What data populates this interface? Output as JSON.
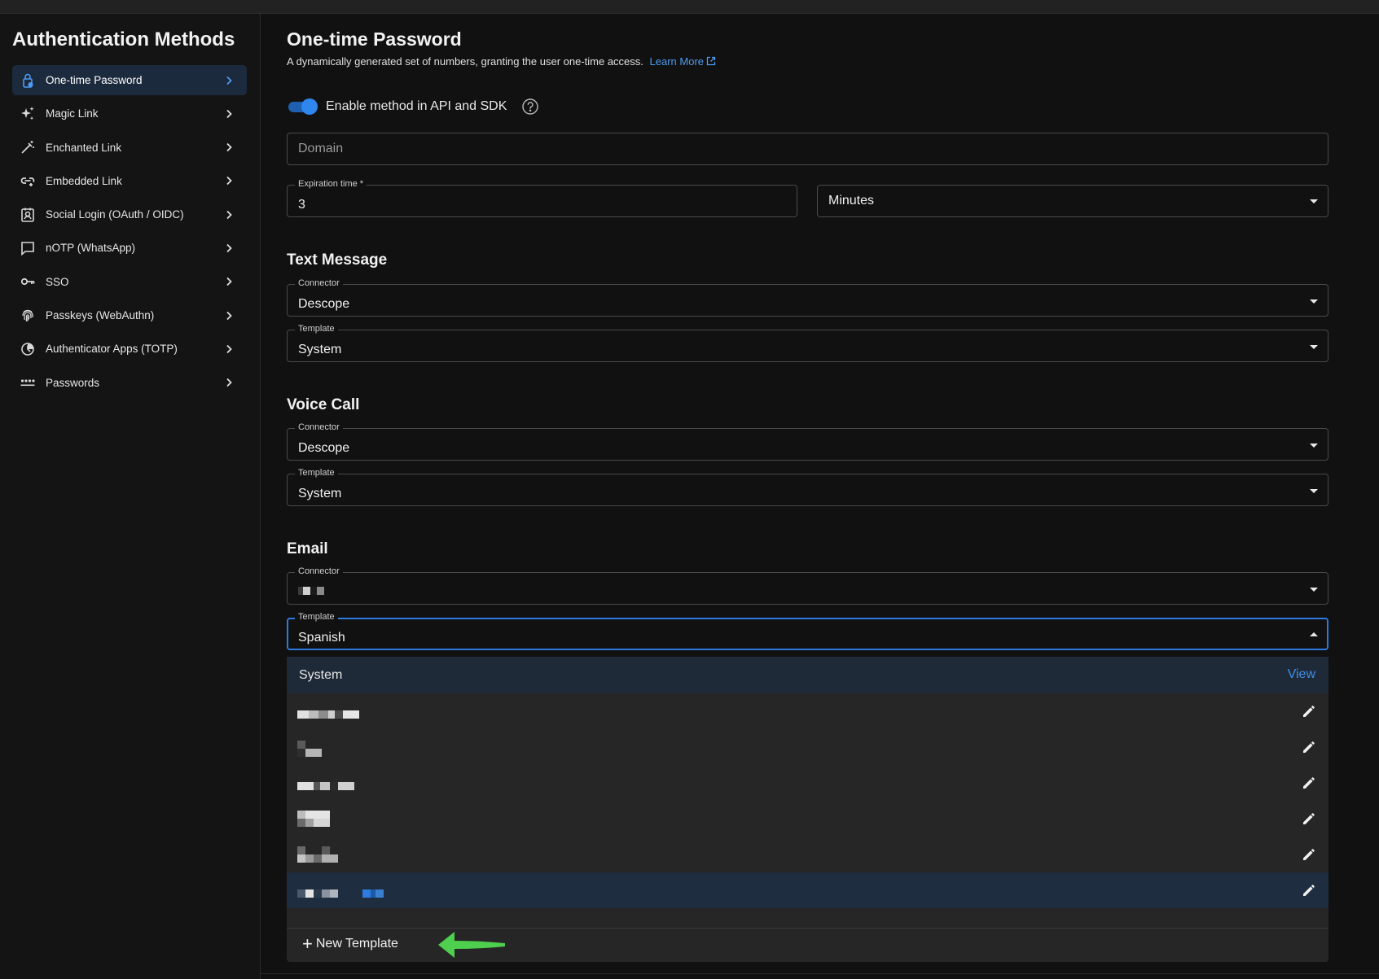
{
  "sidebar": {
    "title": "Authentication Methods",
    "items": [
      {
        "label": "One-time Password",
        "icon": "lock-phone-icon",
        "active": true
      },
      {
        "label": "Magic Link",
        "icon": "sparkles-icon"
      },
      {
        "label": "Enchanted Link",
        "icon": "magic-wand-icon"
      },
      {
        "label": "Embedded Link",
        "icon": "link-icon"
      },
      {
        "label": "Social Login (OAuth / OIDC)",
        "icon": "contact-card-icon"
      },
      {
        "label": "nOTP (WhatsApp)",
        "icon": "chat-bubble-icon"
      },
      {
        "label": "SSO",
        "icon": "key-icon"
      },
      {
        "label": "Passkeys (WebAuthn)",
        "icon": "fingerprint-icon"
      },
      {
        "label": "Authenticator Apps (TOTP)",
        "icon": "timer-icon"
      },
      {
        "label": "Passwords",
        "icon": "password-dots-icon"
      }
    ]
  },
  "page": {
    "title": "One-time Password",
    "description": "A dynamically generated set of numbers, granting the user one-time access.",
    "learn_more": "Learn More"
  },
  "toggle": {
    "label": "Enable method in API and SDK",
    "enabled": true
  },
  "domain": {
    "placeholder": "Domain"
  },
  "expiration": {
    "label": "Expiration time *",
    "value": "3",
    "unit": "Minutes"
  },
  "text_message": {
    "title": "Text Message",
    "connector_label": "Connector",
    "connector_value": "Descope",
    "template_label": "Template",
    "template_value": "System"
  },
  "voice_call": {
    "title": "Voice Call",
    "connector_label": "Connector",
    "connector_value": "Descope",
    "template_label": "Template",
    "template_value": "System"
  },
  "email": {
    "title": "Email",
    "connector_label": "Connector",
    "template_label": "Template",
    "template_value": "Spanish"
  },
  "dropdown": {
    "system_label": "System",
    "view_label": "View",
    "new_template_label": "New Template"
  },
  "colors": {
    "accent": "#2e86ee",
    "link": "#4d9bf0",
    "arrow": "#4ed04e"
  }
}
